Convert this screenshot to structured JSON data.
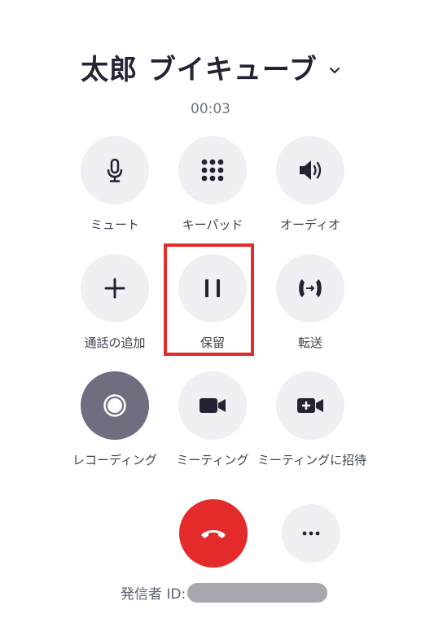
{
  "call": {
    "caller_name": "太郎 ブイキューブ",
    "timer": "00:03",
    "caller_id_label": "発信者 ID:"
  },
  "controls": [
    {
      "label": "ミュート",
      "icon": "microphone-icon"
    },
    {
      "label": "キーパッド",
      "icon": "keypad-icon"
    },
    {
      "label": "オーディオ",
      "icon": "speaker-icon"
    },
    {
      "label": "通話の追加",
      "icon": "plus-icon"
    },
    {
      "label": "保留",
      "icon": "pause-icon"
    },
    {
      "label": "転送",
      "icon": "transfer-icon"
    },
    {
      "label": "レコーディング",
      "icon": "record-icon"
    },
    {
      "label": "ミーティング",
      "icon": "video-camera-icon"
    },
    {
      "label": "ミーティングに招待",
      "icon": "video-camera-plus-icon"
    }
  ],
  "actions": {
    "end_call_icon": "phone-hangup-icon",
    "more_icon": "ellipsis-icon"
  },
  "colors": {
    "end_call": "#e32b2b",
    "highlight": "#e32b2b",
    "button_bg": "#f0f0f4",
    "record_bg": "#6e6e80",
    "icon": "#232333"
  }
}
